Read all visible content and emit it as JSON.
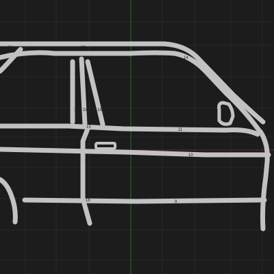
{
  "viewport": {
    "colors": {
      "background": "#1c1c1c",
      "grid": "#2c2c2c",
      "axis_y": "#2f6a2f",
      "axis_x": "#6b2a2a",
      "part": "#c2c2c4",
      "label": "#1e1e1e"
    }
  },
  "parts": [
    {
      "id": "21",
      "label": "21"
    },
    {
      "id": "20",
      "label": "20"
    },
    {
      "id": "14",
      "label": "14"
    },
    {
      "id": "12",
      "label": "12"
    },
    {
      "id": "17",
      "label": "17"
    },
    {
      "id": "18",
      "label": "18"
    },
    {
      "id": "19",
      "label": "19"
    },
    {
      "id": "15",
      "label": "15"
    },
    {
      "id": "11",
      "label": "11"
    },
    {
      "id": "10",
      "label": "10"
    },
    {
      "id": "16",
      "label": "16"
    },
    {
      "id": "9",
      "label": "9"
    }
  ]
}
